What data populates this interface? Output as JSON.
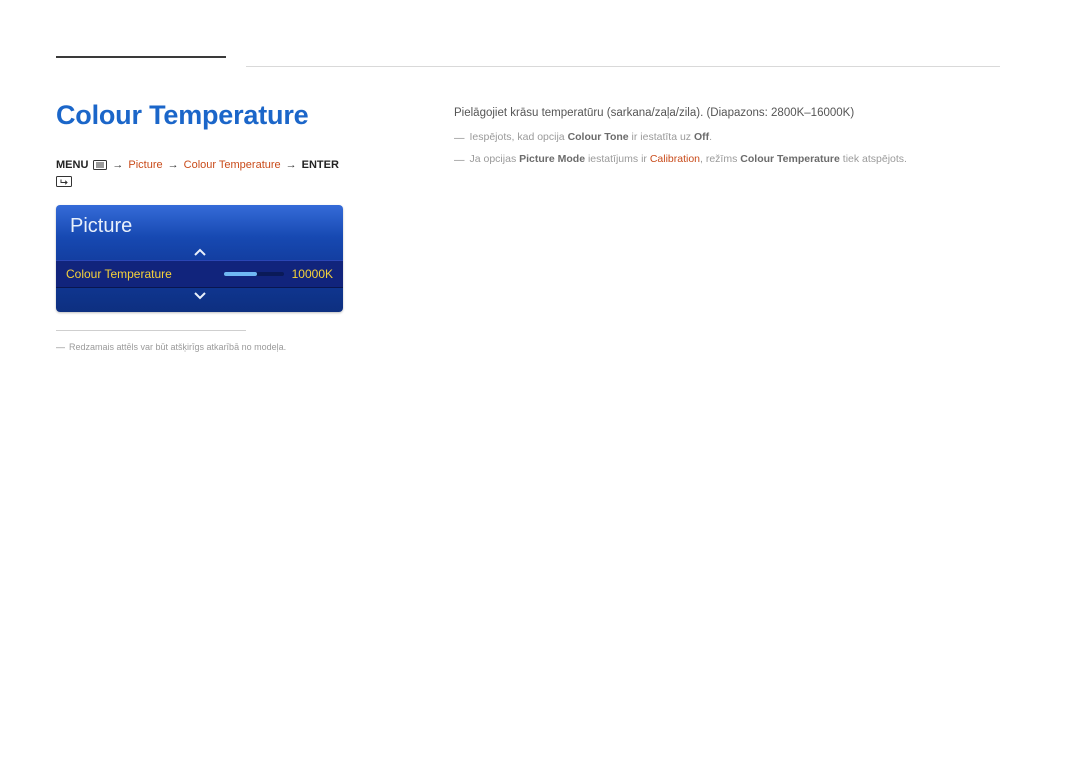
{
  "heading": "Colour Temperature",
  "breadcrumb": {
    "menu": "MENU",
    "picture": "Picture",
    "item": "Colour Temperature",
    "enter": "ENTER",
    "arrow": "→"
  },
  "osd": {
    "header": "Picture",
    "row_label": "Colour Temperature",
    "row_value": "10000K",
    "slider_percent": 55
  },
  "footnote": "Redzamais attēls var būt atšķirīgs atkarībā no modeļa.",
  "right": {
    "p1": "Pielāgojiet krāsu temperatūru (sarkana/zaļa/zila). (Diapazons: 2800K–16000K)",
    "n1_a": "Iespējots, kad opcija ",
    "n1_b": "Colour Tone",
    "n1_c": " ir iestatīta uz ",
    "n1_d": "Off",
    "n1_e": ".",
    "n2_a": "Ja opcijas ",
    "n2_b": "Picture Mode",
    "n2_c": " iestatījums ir ",
    "n2_d": "Calibration",
    "n2_e": ", režīms ",
    "n2_f": "Colour Temperature",
    "n2_g": " tiek atspējots."
  },
  "dash": "―"
}
